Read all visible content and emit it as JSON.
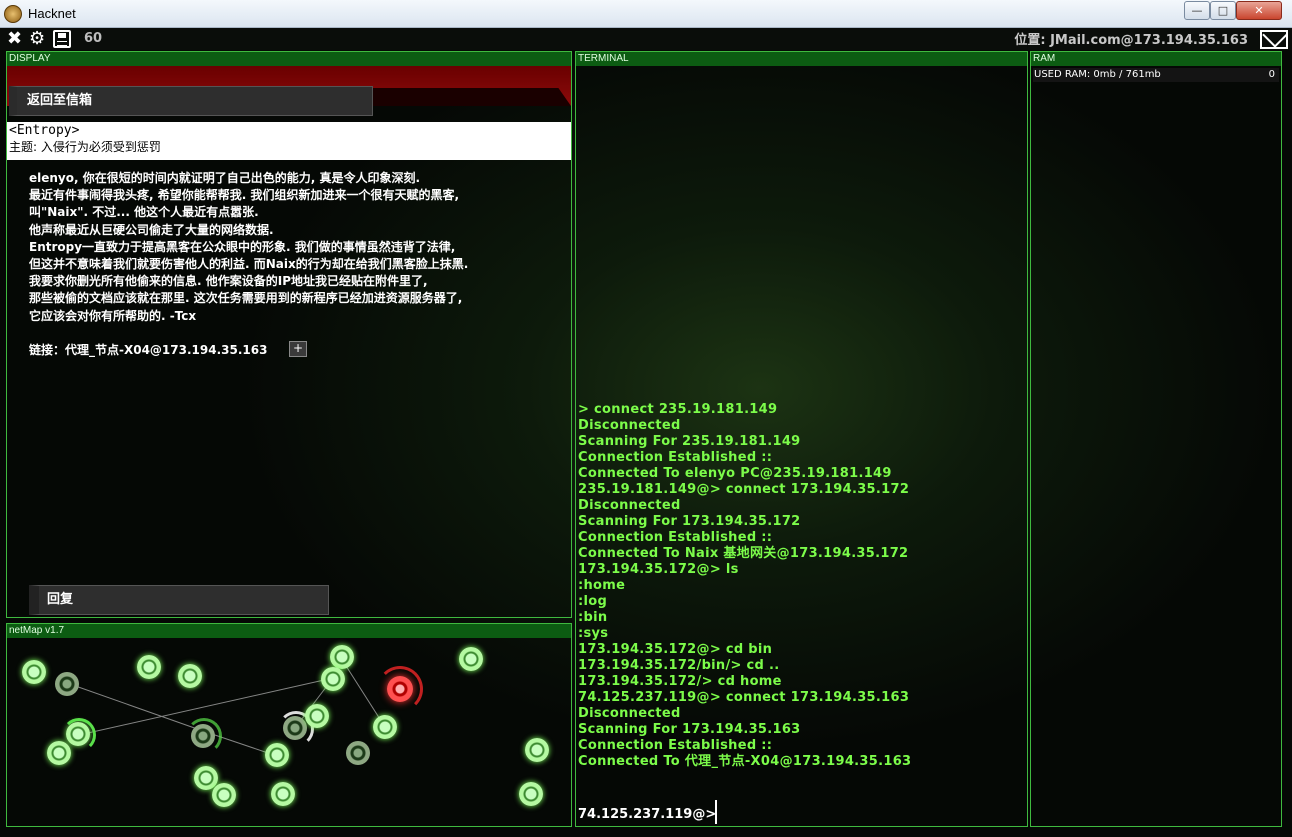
{
  "window": {
    "title": "Hacknet",
    "btn_min": "—",
    "btn_max": "□",
    "btn_close": "✕"
  },
  "topbar": {
    "counter": "60",
    "location": "位置: JMail.com@173.194.35.163"
  },
  "panels": {
    "display": "DISPLAY",
    "terminal": "TERMINAL",
    "ram": "RAM",
    "netmap": "netMap v1.7"
  },
  "mail": {
    "back_label": "返回至信箱",
    "sender": "<Entropy>",
    "subject": "主题: 入侵行为必须受到惩罚",
    "body": [
      "elenyo, 你在很短的时间内就证明了自己出色的能力, 真是令人印象深刻.",
      "最近有件事闹得我头疼, 希望你能帮帮我. 我们组织新加进来一个很有天赋的黑客,",
      "叫\"Naix\". 不过... 他这个人最近有点嚣张.",
      "他声称最近从巨硬公司偷走了大量的网络数据.",
      "Entropy一直致力于提高黑客在公众眼中的形象. 我们做的事情虽然违背了法律,",
      "但这并不意味着我们就要伤害他人的利益. 而Naix的行为却在给我们黑客脸上抹黑.",
      "我要求你删光所有他偷来的信息. 他作案设备的IP地址我已经贴在附件里了,",
      "那些被偷的文档应该就在那里. 这次任务需要用到的新程序已经加进资源服务器了,",
      "它应该会对你有所帮助的. -Tcx"
    ],
    "link": "链接：代理_节点-X04@173.194.35.163",
    "link_button": "+",
    "reply_label": "回复"
  },
  "terminal": {
    "lines": [
      "> connect 235.19.181.149",
      "Disconnected",
      "Scanning For 235.19.181.149",
      "Connection Established ::",
      "Connected To elenyo PC@235.19.181.149",
      "235.19.181.149@> connect 173.194.35.172",
      "Disconnected",
      "Scanning For 173.194.35.172",
      "Connection Established ::",
      "Connected To Naix 基地网关@173.194.35.172",
      "173.194.35.172@> ls",
      ":home",
      ":log",
      ":bin",
      ":sys",
      "173.194.35.172@> cd bin",
      "173.194.35.172/bin/> cd ..",
      "173.194.35.172/> cd home",
      "74.125.237.119@> connect 173.194.35.163",
      "Disconnected",
      "Scanning For 173.194.35.163",
      "Connection Established ::",
      "Connected To 代理_节点-X04@173.194.35.163"
    ],
    "prompt": "74.125.237.119@>"
  },
  "ram": {
    "label": "USED RAM: 0mb / 761mb",
    "count": "0"
  },
  "colors": {
    "accent_green": "#3fb93f",
    "terminal_text": "#7cfc4a",
    "header_green": "#0c5c12",
    "alert_red": "#8c0b0b"
  },
  "icons": [
    "close-icon",
    "gear-icon",
    "save-icon",
    "mail-icon",
    "app-icon"
  ]
}
